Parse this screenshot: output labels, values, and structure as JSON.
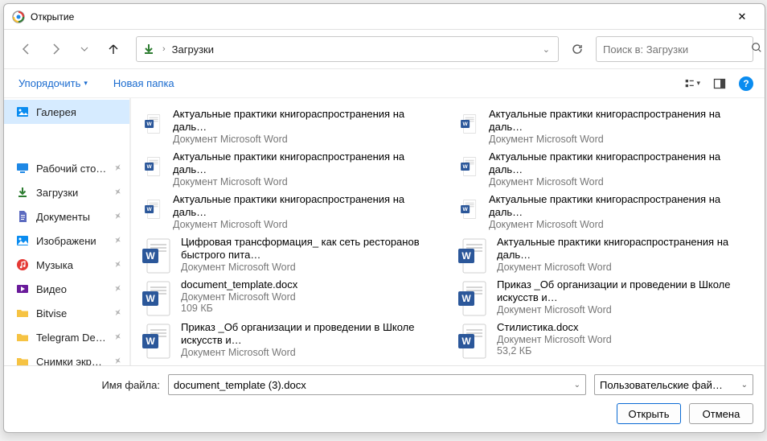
{
  "window": {
    "title": "Открытие",
    "close_label": "✕"
  },
  "nav": {
    "path_text": "Загрузки",
    "search_placeholder": "Поиск в: Загрузки"
  },
  "toolbar": {
    "organize": "Упорядочить",
    "new_folder": "Новая папка"
  },
  "sidebar": {
    "gallery": "Галерея",
    "items": [
      {
        "label": "Рабочий сто…",
        "icon": "desktop",
        "color": "#1e88e5"
      },
      {
        "label": "Загрузки",
        "icon": "download",
        "color": "#2e7d32"
      },
      {
        "label": "Документы",
        "icon": "document",
        "color": "#5c6bc0"
      },
      {
        "label": "Изображени",
        "icon": "pictures",
        "color": "#0a8cf0"
      },
      {
        "label": "Музыка",
        "icon": "music",
        "color": "#e53935"
      },
      {
        "label": "Видео",
        "icon": "video",
        "color": "#6a1b9a"
      },
      {
        "label": "Bitvise",
        "icon": "folder",
        "color": "#f6c343"
      },
      {
        "label": "Telegram Deskto",
        "icon": "folder",
        "color": "#f6c343"
      },
      {
        "label": "Снимки экрана",
        "icon": "folder",
        "color": "#f6c343"
      }
    ]
  },
  "files": {
    "columns": [
      [
        {
          "title": "Актуальные практики книгораспространения на даль…",
          "type": "Документ Microsoft Word",
          "size": "",
          "big": false
        },
        {
          "title": "Актуальные практики книгораспространения на даль…",
          "type": "Документ Microsoft Word",
          "size": "",
          "big": false
        },
        {
          "title": "Актуальные практики книгораспространения на даль…",
          "type": "Документ Microsoft Word",
          "size": "",
          "big": false
        },
        {
          "title": "Цифровая трансформация_ как сеть ресторанов быстрого пита…",
          "type": "Документ Microsoft Word",
          "size": "",
          "big": true
        },
        {
          "title": "document_template.docx",
          "type": "Документ Microsoft Word",
          "size": "109 КБ",
          "big": true
        },
        {
          "title": "Приказ _Об организации и проведении в Школе искусств и…",
          "type": "Документ Microsoft Word",
          "size": "",
          "big": true
        }
      ],
      [
        {
          "title": "Актуальные практики книгораспространения на даль…",
          "type": "Документ Microsoft Word",
          "size": "",
          "big": false
        },
        {
          "title": "Актуальные практики книгораспространения на даль…",
          "type": "Документ Microsoft Word",
          "size": "",
          "big": false
        },
        {
          "title": "Актуальные практики книгораспространения на даль…",
          "type": "Документ Microsoft Word",
          "size": "",
          "big": false
        },
        {
          "title": "Актуальные практики книгораспространения на даль…",
          "type": "Документ Microsoft Word",
          "size": "",
          "big": true
        },
        {
          "title": "Приказ _Об организации и проведении в Школе искусств и…",
          "type": "Документ Microsoft Word",
          "size": "",
          "big": true
        },
        {
          "title": "Стилистика.docx",
          "type": "Документ Microsoft Word",
          "size": "53,2 КБ",
          "big": true
        }
      ]
    ]
  },
  "footer": {
    "filename_label": "Имя файла:",
    "filename_value": "document_template (3).docx",
    "filetype_value": "Пользовательские файлы (*.d",
    "open": "Открыть",
    "cancel": "Отмена"
  }
}
